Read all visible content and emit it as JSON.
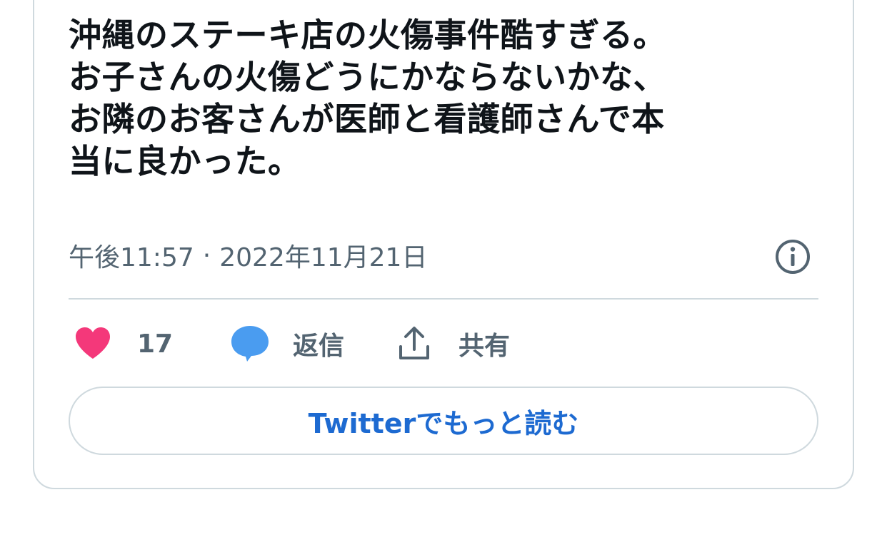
{
  "tweet": {
    "text_lines": [
      "沖縄のステーキ店の火傷事件酷すぎる。",
      "お子さんの火傷どうにかならないかな、",
      "お隣のお客さんが医師と看護師さんで本",
      "当に良かった。"
    ],
    "time": "午後11:57",
    "separator": "·",
    "date": "2022年11月21日"
  },
  "actions": {
    "like": {
      "icon": "heart-icon",
      "count": "17",
      "color": "#f4387a"
    },
    "reply": {
      "icon": "speech-bubble-icon",
      "label": "返信",
      "color": "#4a9cf0"
    },
    "share": {
      "icon": "share-upload-icon",
      "label": "共有"
    }
  },
  "info": {
    "icon": "info-icon"
  },
  "read_more": {
    "label": "Twitterでもっと読む",
    "color": "#1d6ad1"
  }
}
